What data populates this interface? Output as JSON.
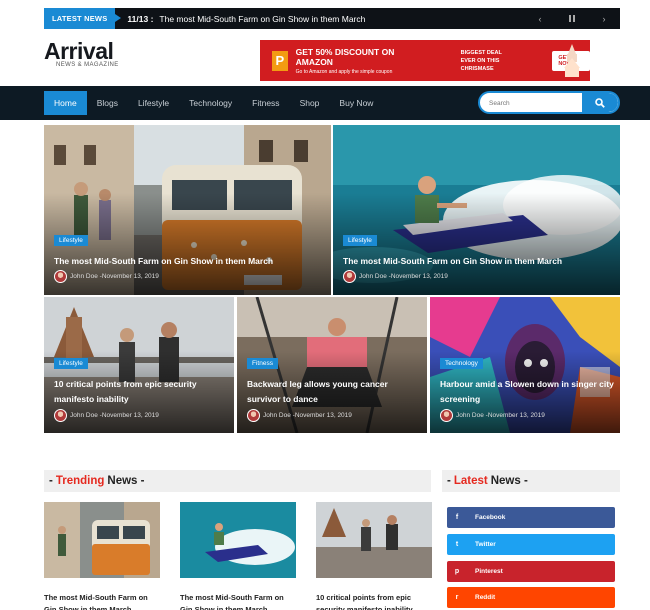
{
  "ticker": {
    "label": "LATEST NEWS",
    "count": "11/13 :",
    "text": "The most Mid-South Farm on Gin Show in them March",
    "prev": "‹",
    "pause": "⏸",
    "next": "›"
  },
  "logo": {
    "title": "Arrival",
    "subtitle": "NEWS & MAGAZINE"
  },
  "ad": {
    "icon_letter": "P",
    "title": "GET 50% DISCOUNT ON AMAZON",
    "subtitle": "Go to Amazon and apply the simple coupon",
    "deal_line1": "BIGGEST DEAL",
    "deal_line2": "EVER ON THIS CHRISMASE",
    "button": "GET NOW"
  },
  "nav": {
    "items": [
      "Home",
      "Blogs",
      "Lifestyle",
      "Technology",
      "Fitness",
      "Shop",
      "Buy Now"
    ],
    "search_placeholder": "Search"
  },
  "features": [
    {
      "category": "Lifestyle",
      "title": "The most Mid-South Farm on Gin Show in them March",
      "author": "John Doe",
      "date": "November 13, 2019"
    },
    {
      "category": "Lifestyle",
      "title": "The most Mid-South Farm on Gin Show in them March",
      "author": "John Doe",
      "date": "November 13, 2019"
    },
    {
      "category": "Lifestyle",
      "title": "10 critical points from epic security manifesto inability",
      "author": "John Doe",
      "date": "November 13, 2019"
    },
    {
      "category": "Fitness",
      "title": "Backward leg allows young cancer survivor to dance",
      "author": "John Doe",
      "date": "November 13, 2019"
    },
    {
      "category": "Technology",
      "title": "Harbour amid a Slowen down in singer city screening",
      "author": "John Doe",
      "date": "November 13, 2019"
    }
  ],
  "trending": {
    "prefix": "-",
    "accent": "Trending",
    "rest": "News -",
    "items": [
      "The most Mid-South Farm on Gin Show in them March",
      "The most Mid-South Farm on Gin Show in them March",
      "10 critical points from epic security manifesto inability"
    ]
  },
  "latest": {
    "prefix": "-",
    "accent": "Latest",
    "rest": "News -",
    "social": [
      {
        "label": "Facebook",
        "icon": "facebook-icon",
        "glyph": "f",
        "color": "#3b5998"
      },
      {
        "label": "Twitter",
        "icon": "twitter-icon",
        "glyph": "t",
        "color": "#1da1f2"
      },
      {
        "label": "Pinterest",
        "icon": "pinterest-icon",
        "glyph": "p",
        "color": "#c8232c"
      },
      {
        "label": "Reddit",
        "icon": "reddit-icon",
        "glyph": "r",
        "color": "#ff4500"
      }
    ]
  },
  "colors": {
    "accent": "#1a8ad4",
    "nav_bg": "#0d1a24",
    "ticker_bg": "#0e1217",
    "trend_red": "#e5291f"
  }
}
